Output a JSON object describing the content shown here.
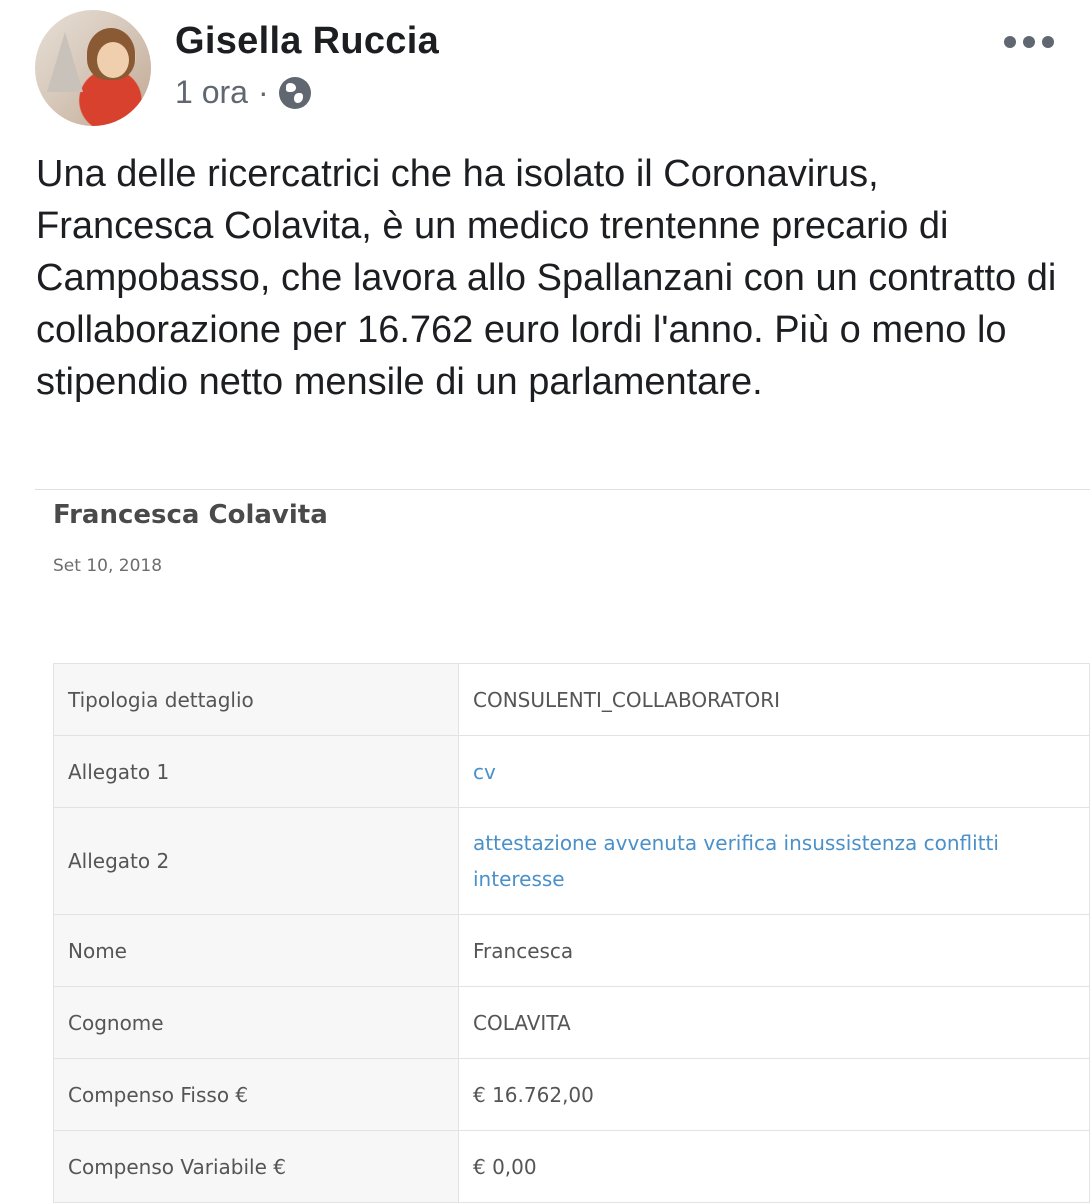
{
  "post": {
    "author": "Gisella Ruccia",
    "time": "1 ora",
    "separator": "·",
    "privacy_icon": "globe-icon",
    "more_icon": "ellipsis-icon",
    "text": "Una delle ricercatrici che ha isolato il Coronavirus, Francesca Colavita, è un medico trentenne precario di Campobasso, che lavora allo Spallanzani con un contratto di collaborazione per 16.762 euro lordi l'anno. Più o meno lo stipendio netto mensile di un parlamentare."
  },
  "document": {
    "title": "Francesca Colavita",
    "date": "Set 10, 2018",
    "rows": [
      {
        "label": "Tipologia dettaglio",
        "value": "CONSULENTI_COLLABORATORI"
      },
      {
        "label": "Allegato 1",
        "value": "cv"
      },
      {
        "label": "Allegato 2",
        "value": "attestazione avvenuta verifica insussistenza conflitti interesse"
      },
      {
        "label": "Nome",
        "value": "Francesca"
      },
      {
        "label": "Cognome",
        "value": "COLAVITA"
      },
      {
        "label": "Compenso Fisso €",
        "value": "€ 16.762,00"
      },
      {
        "label": "Compenso Variabile €",
        "value": "€ 0,00"
      }
    ]
  },
  "colors": {
    "link": "#4a90c9",
    "secondary_text": "#606770"
  }
}
